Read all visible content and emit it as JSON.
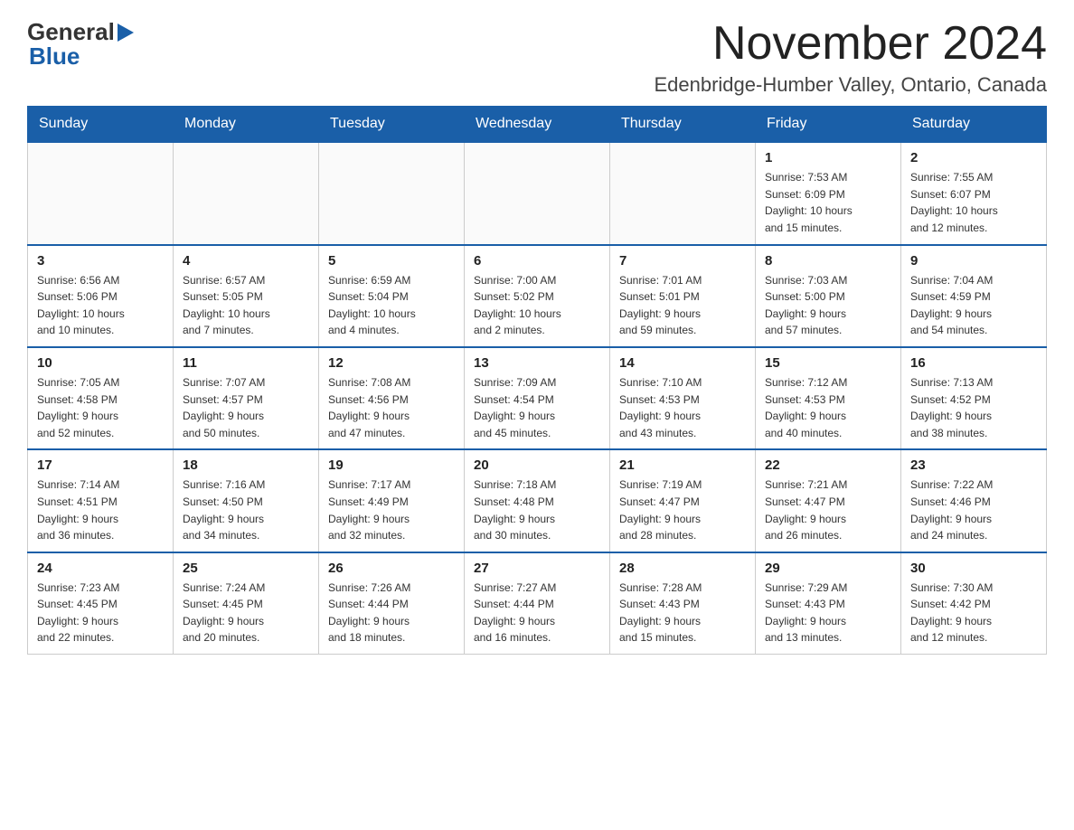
{
  "logo": {
    "general_text": "General",
    "blue_text": "Blue"
  },
  "header": {
    "month_year": "November 2024",
    "location": "Edenbridge-Humber Valley, Ontario, Canada"
  },
  "weekdays": [
    "Sunday",
    "Monday",
    "Tuesday",
    "Wednesday",
    "Thursday",
    "Friday",
    "Saturday"
  ],
  "weeks": [
    [
      {
        "day": "",
        "info": []
      },
      {
        "day": "",
        "info": []
      },
      {
        "day": "",
        "info": []
      },
      {
        "day": "",
        "info": []
      },
      {
        "day": "",
        "info": []
      },
      {
        "day": "1",
        "info": [
          "Sunrise: 7:53 AM",
          "Sunset: 6:09 PM",
          "Daylight: 10 hours",
          "and 15 minutes."
        ]
      },
      {
        "day": "2",
        "info": [
          "Sunrise: 7:55 AM",
          "Sunset: 6:07 PM",
          "Daylight: 10 hours",
          "and 12 minutes."
        ]
      }
    ],
    [
      {
        "day": "3",
        "info": [
          "Sunrise: 6:56 AM",
          "Sunset: 5:06 PM",
          "Daylight: 10 hours",
          "and 10 minutes."
        ]
      },
      {
        "day": "4",
        "info": [
          "Sunrise: 6:57 AM",
          "Sunset: 5:05 PM",
          "Daylight: 10 hours",
          "and 7 minutes."
        ]
      },
      {
        "day": "5",
        "info": [
          "Sunrise: 6:59 AM",
          "Sunset: 5:04 PM",
          "Daylight: 10 hours",
          "and 4 minutes."
        ]
      },
      {
        "day": "6",
        "info": [
          "Sunrise: 7:00 AM",
          "Sunset: 5:02 PM",
          "Daylight: 10 hours",
          "and 2 minutes."
        ]
      },
      {
        "day": "7",
        "info": [
          "Sunrise: 7:01 AM",
          "Sunset: 5:01 PM",
          "Daylight: 9 hours",
          "and 59 minutes."
        ]
      },
      {
        "day": "8",
        "info": [
          "Sunrise: 7:03 AM",
          "Sunset: 5:00 PM",
          "Daylight: 9 hours",
          "and 57 minutes."
        ]
      },
      {
        "day": "9",
        "info": [
          "Sunrise: 7:04 AM",
          "Sunset: 4:59 PM",
          "Daylight: 9 hours",
          "and 54 minutes."
        ]
      }
    ],
    [
      {
        "day": "10",
        "info": [
          "Sunrise: 7:05 AM",
          "Sunset: 4:58 PM",
          "Daylight: 9 hours",
          "and 52 minutes."
        ]
      },
      {
        "day": "11",
        "info": [
          "Sunrise: 7:07 AM",
          "Sunset: 4:57 PM",
          "Daylight: 9 hours",
          "and 50 minutes."
        ]
      },
      {
        "day": "12",
        "info": [
          "Sunrise: 7:08 AM",
          "Sunset: 4:56 PM",
          "Daylight: 9 hours",
          "and 47 minutes."
        ]
      },
      {
        "day": "13",
        "info": [
          "Sunrise: 7:09 AM",
          "Sunset: 4:54 PM",
          "Daylight: 9 hours",
          "and 45 minutes."
        ]
      },
      {
        "day": "14",
        "info": [
          "Sunrise: 7:10 AM",
          "Sunset: 4:53 PM",
          "Daylight: 9 hours",
          "and 43 minutes."
        ]
      },
      {
        "day": "15",
        "info": [
          "Sunrise: 7:12 AM",
          "Sunset: 4:53 PM",
          "Daylight: 9 hours",
          "and 40 minutes."
        ]
      },
      {
        "day": "16",
        "info": [
          "Sunrise: 7:13 AM",
          "Sunset: 4:52 PM",
          "Daylight: 9 hours",
          "and 38 minutes."
        ]
      }
    ],
    [
      {
        "day": "17",
        "info": [
          "Sunrise: 7:14 AM",
          "Sunset: 4:51 PM",
          "Daylight: 9 hours",
          "and 36 minutes."
        ]
      },
      {
        "day": "18",
        "info": [
          "Sunrise: 7:16 AM",
          "Sunset: 4:50 PM",
          "Daylight: 9 hours",
          "and 34 minutes."
        ]
      },
      {
        "day": "19",
        "info": [
          "Sunrise: 7:17 AM",
          "Sunset: 4:49 PM",
          "Daylight: 9 hours",
          "and 32 minutes."
        ]
      },
      {
        "day": "20",
        "info": [
          "Sunrise: 7:18 AM",
          "Sunset: 4:48 PM",
          "Daylight: 9 hours",
          "and 30 minutes."
        ]
      },
      {
        "day": "21",
        "info": [
          "Sunrise: 7:19 AM",
          "Sunset: 4:47 PM",
          "Daylight: 9 hours",
          "and 28 minutes."
        ]
      },
      {
        "day": "22",
        "info": [
          "Sunrise: 7:21 AM",
          "Sunset: 4:47 PM",
          "Daylight: 9 hours",
          "and 26 minutes."
        ]
      },
      {
        "day": "23",
        "info": [
          "Sunrise: 7:22 AM",
          "Sunset: 4:46 PM",
          "Daylight: 9 hours",
          "and 24 minutes."
        ]
      }
    ],
    [
      {
        "day": "24",
        "info": [
          "Sunrise: 7:23 AM",
          "Sunset: 4:45 PM",
          "Daylight: 9 hours",
          "and 22 minutes."
        ]
      },
      {
        "day": "25",
        "info": [
          "Sunrise: 7:24 AM",
          "Sunset: 4:45 PM",
          "Daylight: 9 hours",
          "and 20 minutes."
        ]
      },
      {
        "day": "26",
        "info": [
          "Sunrise: 7:26 AM",
          "Sunset: 4:44 PM",
          "Daylight: 9 hours",
          "and 18 minutes."
        ]
      },
      {
        "day": "27",
        "info": [
          "Sunrise: 7:27 AM",
          "Sunset: 4:44 PM",
          "Daylight: 9 hours",
          "and 16 minutes."
        ]
      },
      {
        "day": "28",
        "info": [
          "Sunrise: 7:28 AM",
          "Sunset: 4:43 PM",
          "Daylight: 9 hours",
          "and 15 minutes."
        ]
      },
      {
        "day": "29",
        "info": [
          "Sunrise: 7:29 AM",
          "Sunset: 4:43 PM",
          "Daylight: 9 hours",
          "and 13 minutes."
        ]
      },
      {
        "day": "30",
        "info": [
          "Sunrise: 7:30 AM",
          "Sunset: 4:42 PM",
          "Daylight: 9 hours",
          "and 12 minutes."
        ]
      }
    ]
  ]
}
